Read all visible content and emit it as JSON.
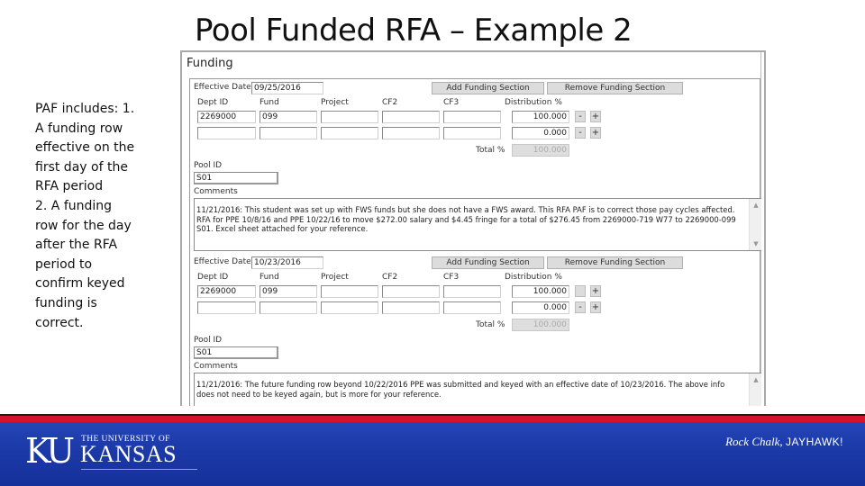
{
  "slide": {
    "title": "Pool Funded RFA – Example 2",
    "side_note_lines": [
      "PAF includes:  1.",
      "A funding row",
      "effective on the",
      "first day of the",
      "RFA period",
      "2. A funding",
      "row for the day",
      "after the RFA",
      "period to",
      "confirm keyed",
      "funding is",
      "correct."
    ]
  },
  "funding": {
    "header": "Funding",
    "labels": {
      "effective_date": "Effective Date:",
      "dept_id": "Dept ID",
      "fund": "Fund",
      "project": "Project",
      "cf2": "CF2",
      "cf3": "CF3",
      "distribution": "Distribution %",
      "total": "Total %",
      "pool_id": "Pool ID",
      "comments": "Comments"
    },
    "buttons": {
      "add": "Add Funding Section",
      "remove": "Remove Funding Section",
      "minus": "-",
      "plus": "+"
    },
    "sections": [
      {
        "effective_date": "09/25/2016",
        "rows": [
          {
            "dept_id": "2269000",
            "fund": "099",
            "project": "",
            "cf2": "",
            "cf3": "",
            "distribution": "100.000"
          },
          {
            "dept_id": "",
            "fund": "",
            "project": "",
            "cf2": "",
            "cf3": "",
            "distribution": "0.000"
          }
        ],
        "total": "100.000",
        "pool_id": "S01",
        "comment_lines": [
          "11/21/2016: This student was set up with FWS funds but she does not have a FWS award. This RFA PAF is to correct those pay cycles affected.",
          "RFA for PPE 10/8/16 and PPE 10/22/16 to move $272.00 salary and $4.45 fringe for a total of $276.45 from 2269000-719 W77 to 2269000-099",
          "S01. Excel sheet attached for your reference."
        ]
      },
      {
        "effective_date": "10/23/2016",
        "rows": [
          {
            "dept_id": "2269000",
            "fund": "099",
            "project": "",
            "cf2": "",
            "cf3": "",
            "distribution": "100.000"
          },
          {
            "dept_id": "",
            "fund": "",
            "project": "",
            "cf2": "",
            "cf3": "",
            "distribution": "0.000"
          }
        ],
        "total": "100.000",
        "pool_id": "S01",
        "comment_lines": [
          "11/21/2016: The future funding row beyond 10/22/2016 PPE was submitted and keyed with an effective date of 10/23/2016. The above info",
          "does not need to be keyed again, but is more for your reference."
        ]
      }
    ]
  },
  "footer": {
    "logo_mark": "KU",
    "logo_univ": "THE UNIVERSITY OF",
    "logo_name": "KANSAS",
    "tagline_italic": "Rock Chalk,",
    "tagline_caps": "JAYHAWK!",
    "colors": {
      "blue": "#1c3aa8",
      "red": "#d4142a"
    }
  }
}
